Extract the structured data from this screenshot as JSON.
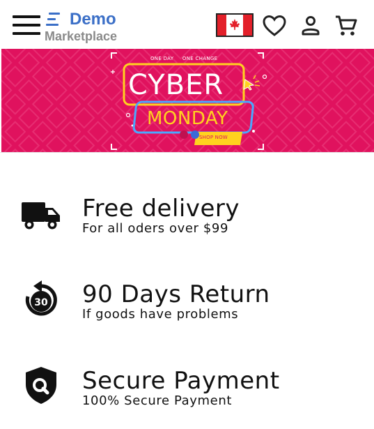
{
  "header": {
    "logo": {
      "title": "Demo",
      "subtitle": "Marketplace"
    },
    "icons": [
      "menu-icon",
      "canada-flag-icon",
      "heart-icon",
      "user-icon",
      "cart-icon"
    ]
  },
  "banner": {
    "top_text": "ONE DAY     ONE CHANGE",
    "line1": "CYBER",
    "line2": "MONDAY",
    "cta": "SHOP NOW",
    "colors": {
      "background": "#e0125e",
      "yellow": "#ffd21f",
      "blue": "#4aa8ff"
    },
    "slides": 2,
    "active_slide": 2
  },
  "features": [
    {
      "title": "Free delivery",
      "subtitle": "For all oders over $99",
      "icon": "delivery-truck-icon"
    },
    {
      "title": "90 Days Return",
      "subtitle": "If goods have problems",
      "icon": "return-30-icon",
      "icon_text": "30"
    },
    {
      "title": "Secure Payment",
      "subtitle": "100% Secure Payment",
      "icon": "secure-shield-icon"
    }
  ]
}
